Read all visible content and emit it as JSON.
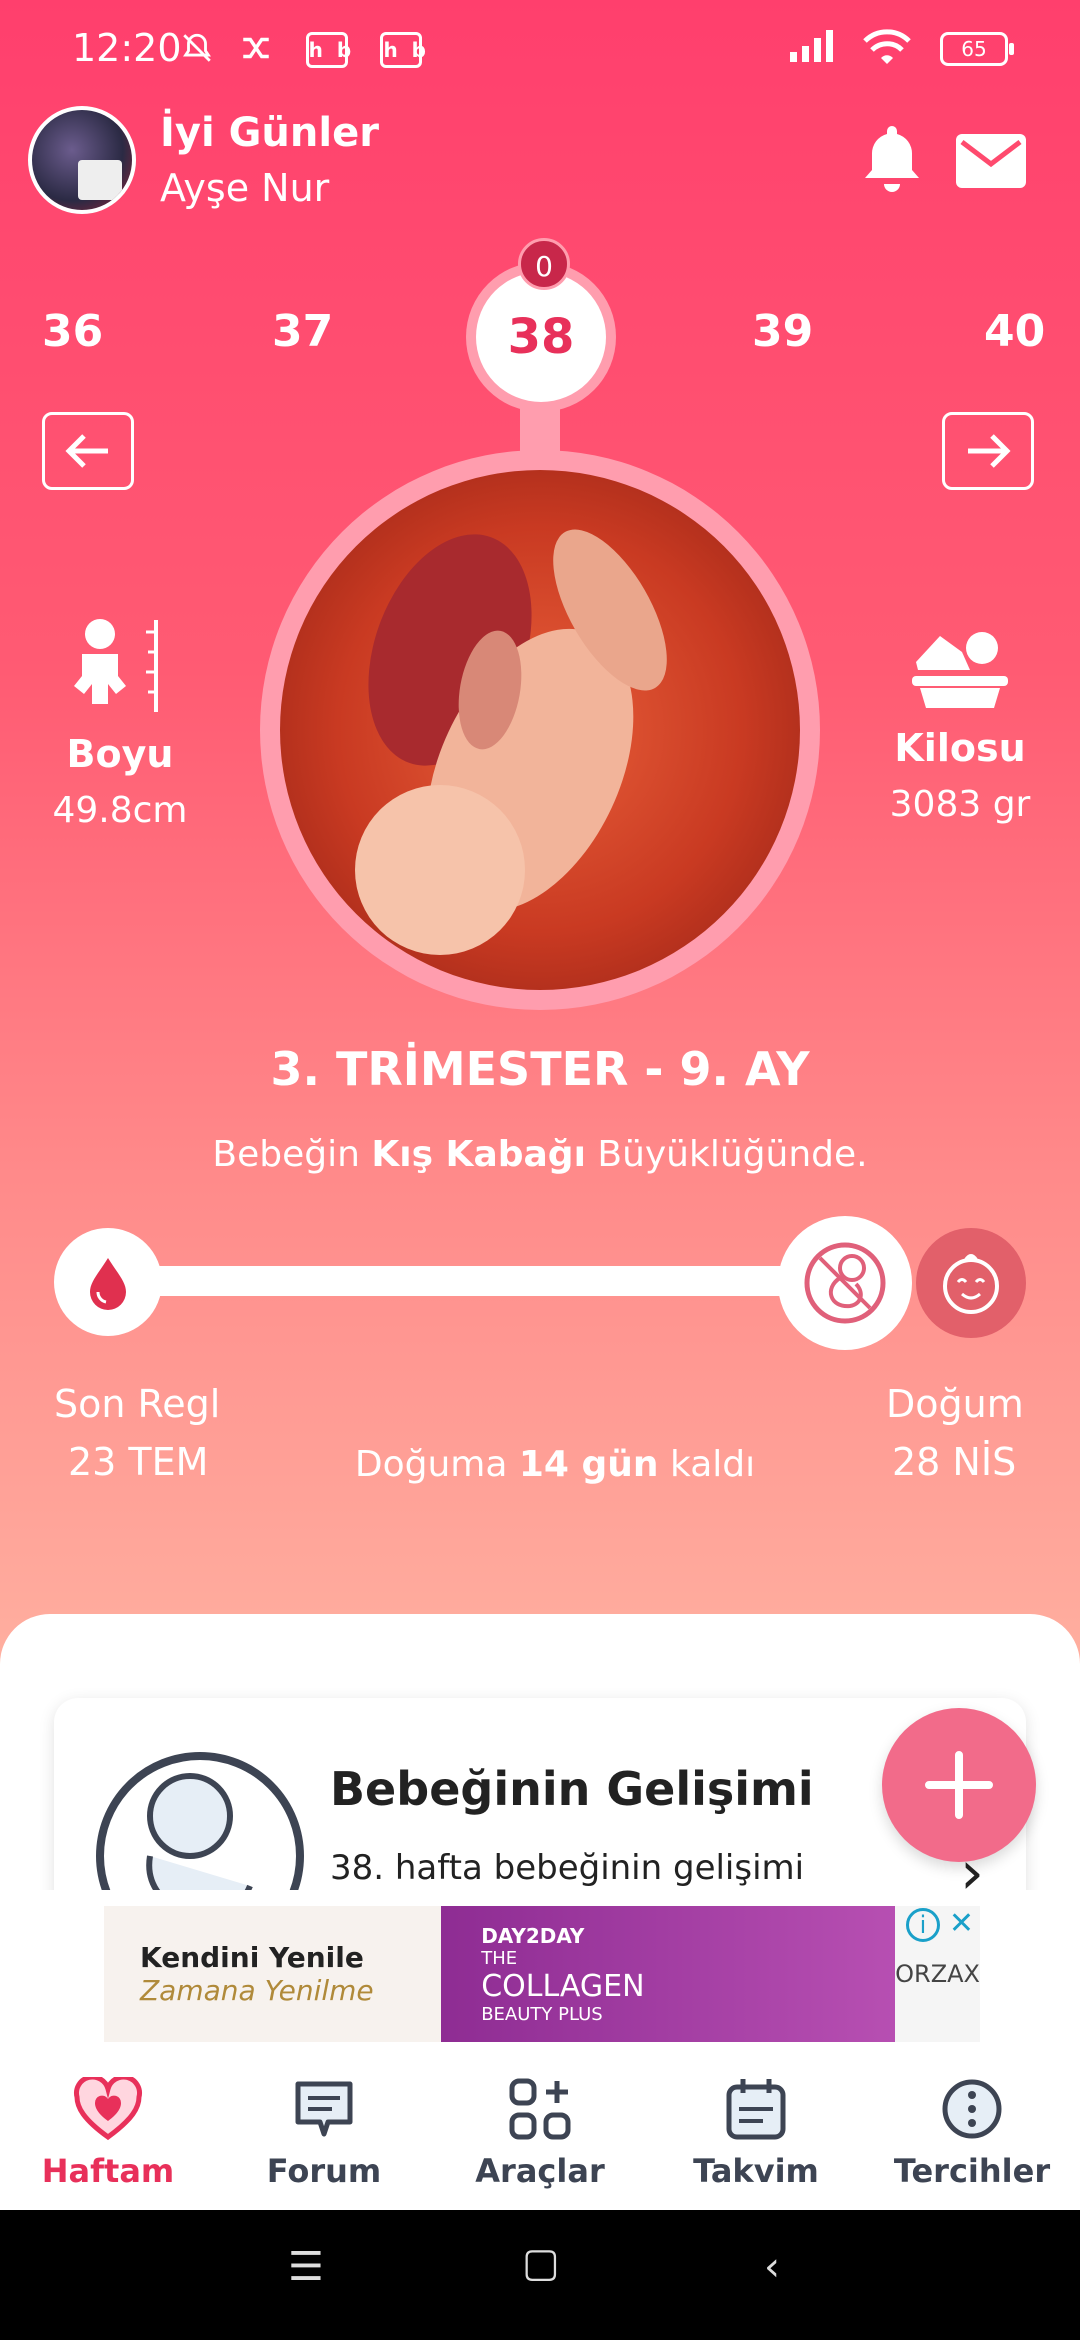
{
  "status_bar": {
    "time": "12:20",
    "badges": [
      "hb",
      "hb"
    ],
    "battery": "65"
  },
  "header": {
    "greeting": "İyi Günler",
    "user_name": "Ayşe Nur"
  },
  "weeks": {
    "items": [
      "36",
      "37",
      "38",
      "39",
      "40"
    ],
    "current": "38",
    "counter": "0"
  },
  "metrics": {
    "height_label": "Boyu",
    "height_value": "49.8cm",
    "weight_label": "Kilosu",
    "weight_value": "3083 gr"
  },
  "trimester": "3. TRİMESTER - 9. AY",
  "size_text": {
    "prefix": "Bebeğin ",
    "fruit": "Kış Kabağı",
    "suffix": " Büyüklüğünde."
  },
  "timeline": {
    "start_label": "Son Regl",
    "start_date": "23 TEM",
    "end_label": "Doğum",
    "end_date": "28 NİS",
    "countdown_prefix": "Doğuma ",
    "countdown_value": "14 gün",
    "countdown_suffix": " kaldı"
  },
  "card": {
    "title": "Bebeğinin Gelişimi",
    "subtitle": "38. hafta bebeğinin gelişimi"
  },
  "ad": {
    "left_line1": "Kendini Yenile",
    "left_line2": "Zamana Yenilme",
    "mid_brand": "DAY2DAY",
    "mid_line1": "THE",
    "mid_line2": "COLLAGEN",
    "mid_line3": "BEAUTY PLUS",
    "right_brand": "ORZAX"
  },
  "tabs": [
    {
      "label": "Haftam",
      "icon": "heart-icon"
    },
    {
      "label": "Forum",
      "icon": "chat-icon"
    },
    {
      "label": "Araçlar",
      "icon": "tools-icon"
    },
    {
      "label": "Takvim",
      "icon": "calendar-icon"
    },
    {
      "label": "Tercihler",
      "icon": "more-icon"
    }
  ],
  "colors": {
    "primary": "#ff3f6d",
    "accent": "#e8305a",
    "ring": "#ff9dae",
    "fab": "#f26b8a"
  }
}
